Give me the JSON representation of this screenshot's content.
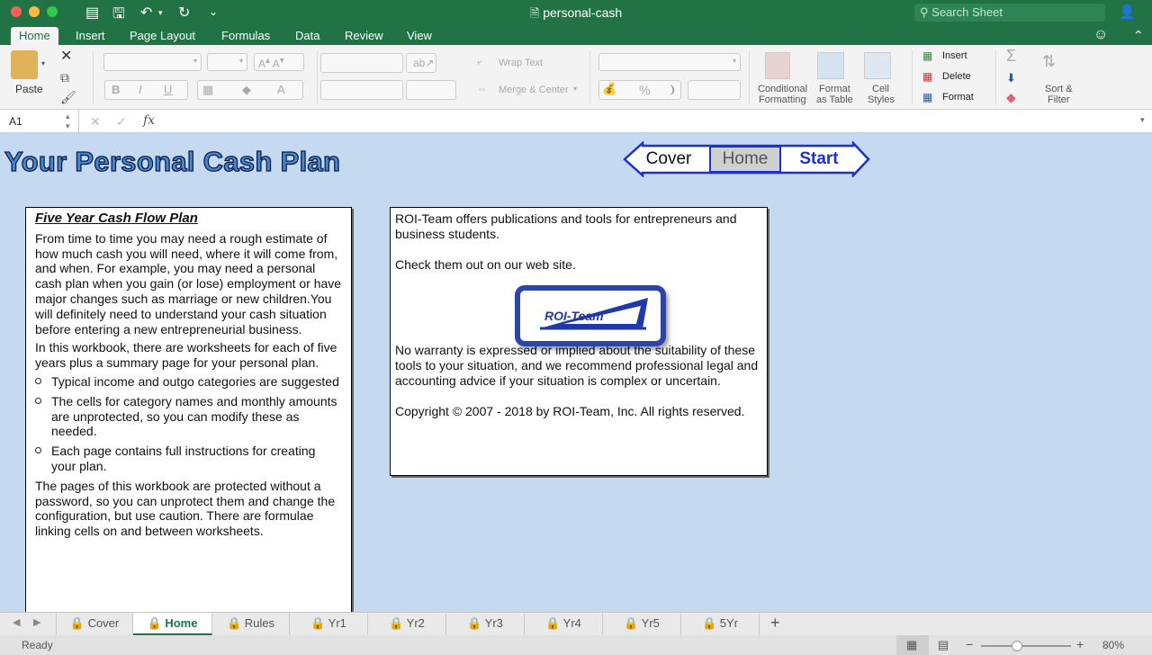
{
  "window": {
    "title": "personal-cash",
    "search_placeholder": "Search Sheet"
  },
  "ribbon_tabs": [
    "Home",
    "Insert",
    "Page Layout",
    "Formulas",
    "Data",
    "Review",
    "View"
  ],
  "ribbon": {
    "paste": "Paste",
    "wrap_text": "Wrap Text",
    "merge_center": "Merge & Center",
    "conditional_1": "Conditional",
    "conditional_2": "Formatting",
    "format_table_1": "Format",
    "format_table_2": "as Table",
    "cell_styles_1": "Cell",
    "cell_styles_2": "Styles",
    "insert": "Insert",
    "delete": "Delete",
    "format": "Format",
    "sort_1": "Sort &",
    "sort_2": "Filter",
    "bold": "B",
    "italic": "I",
    "underline": "U",
    "percent": "%"
  },
  "formula_bar": {
    "cell_ref": "A1",
    "fx": "fx",
    "value": ""
  },
  "sheet": {
    "title": "Your Personal Cash Plan",
    "nav": {
      "cover": "Cover",
      "home": "Home",
      "start": "Start"
    },
    "left_panel": {
      "heading": "Five Year Cash Flow Plan",
      "p1": "From time to time you may need a rough estimate of how much cash you will need, where it will come from, and when. For example, you may need a personal cash plan when you gain (or lose) employment or have major changes such as marriage or new children.You will definitely need to understand your cash situation before entering a new entrepreneurial business.",
      "p2": "In this workbook, there are worksheets for each of five years plus a summary page for your personal plan.",
      "bullets": [
        "Typical income and outgo categories are suggested",
        "The cells for category names and monthly amounts are unprotected, so you can modify these as needed.",
        "Each page contains full instructions for creating your plan."
      ],
      "p3": "The pages of this workbook are protected without a password, so you can unprotect them and change the configuration, but use caution. There are formulae linking cells on and between worksheets."
    },
    "right_panel": {
      "p1": "ROI-Team offers publications and tools for entrepreneurs and business students.",
      "p2": "Check them out on our web site.",
      "logo_text": "ROI-Team",
      "p3": "No warranty is expressed or implied about the suitability of these tools to your situation, and we recommend professional legal and accounting advice if your situation is complex or uncertain.",
      "p4": "Copyright © 2007 - 2018 by ROI-Team, Inc.  All rights reserved."
    }
  },
  "sheet_tabs": [
    "Cover",
    "Home",
    "Rules",
    "Yr1",
    "Yr2",
    "Yr3",
    "Yr4",
    "Yr5",
    "5Yr"
  ],
  "active_sheet": "Home",
  "status": {
    "ready": "Ready",
    "zoom": "80%"
  },
  "colors": {
    "excel_green": "#217346",
    "sheet_bg": "#c5d9f1",
    "nav_blue": "#1e2fd0"
  }
}
